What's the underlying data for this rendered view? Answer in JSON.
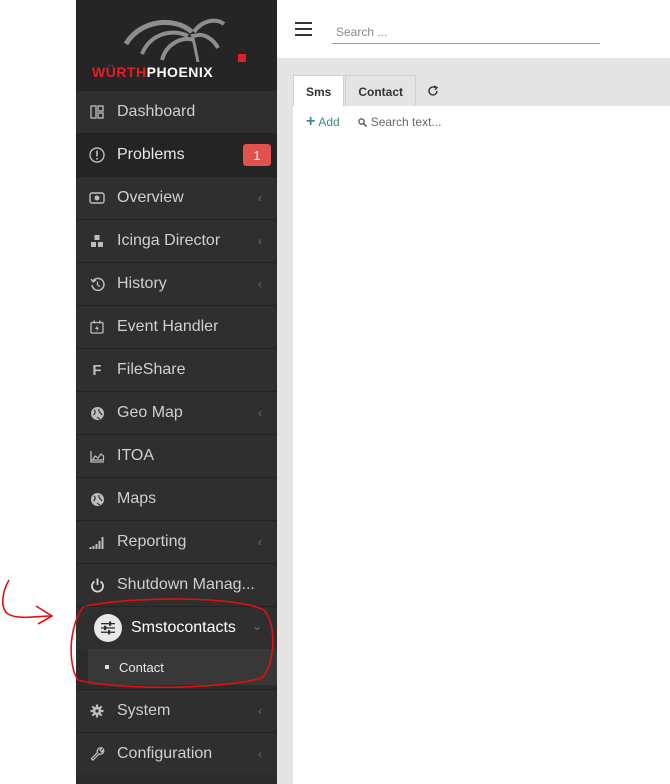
{
  "logo": {
    "brand_red": "WÜRTH",
    "brand_white": "PHOENIX"
  },
  "sidebar": {
    "items": [
      {
        "label": "Dashboard",
        "icon": "dashboard-icon"
      },
      {
        "label": "Problems",
        "icon": "alert-circle-icon",
        "badge": "1"
      },
      {
        "label": "Overview",
        "icon": "eye-icon"
      },
      {
        "label": "Icinga Director",
        "icon": "cubes-icon"
      },
      {
        "label": "History",
        "icon": "history-icon"
      },
      {
        "label": "Event Handler",
        "icon": "event-handler-icon"
      },
      {
        "label": "FileShare",
        "icon": "fileshare-icon",
        "glyph": "F"
      },
      {
        "label": "Geo Map",
        "icon": "globe-icon"
      },
      {
        "label": "ITOA",
        "icon": "chart-area-icon"
      },
      {
        "label": "Maps",
        "icon": "globe-icon"
      },
      {
        "label": "Reporting",
        "icon": "signal-icon"
      },
      {
        "label": "Shutdown Manag...",
        "icon": "power-icon"
      },
      {
        "label": "Smstocontacts",
        "icon": "sliders-icon"
      },
      {
        "label": "System",
        "icon": "gear-icon"
      },
      {
        "label": "Configuration",
        "icon": "wrench-icon"
      }
    ],
    "submenu": {
      "label": "Contact"
    }
  },
  "topbar": {
    "search_placeholder": "Search ..."
  },
  "tabs": [
    {
      "label": "Sms"
    },
    {
      "label": "Contact"
    }
  ],
  "toolbar": {
    "add_label": "Add",
    "search_placeholder": "Search text..."
  },
  "colors": {
    "badge": "#e3514f",
    "brand": "#e31e24",
    "add": "#3a8c8c",
    "annotation": "#e01010"
  }
}
